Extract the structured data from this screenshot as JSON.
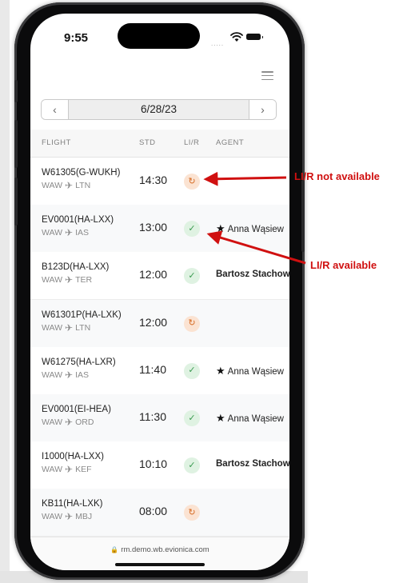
{
  "status_bar": {
    "time": "9:55",
    "signal": "....."
  },
  "date_nav": {
    "prev": "‹",
    "date": "6/28/23",
    "next": "›"
  },
  "table": {
    "headers": {
      "flight": "FLIGHT",
      "std": "STD",
      "lir": "LI/R",
      "agent": "AGENT"
    },
    "rows": [
      {
        "flight": "W61305(G-WUKH)",
        "from": "WAW",
        "to": "LTN",
        "std": "14:30",
        "lir": "not_available",
        "agent": "",
        "starred": false
      },
      {
        "flight": "EV0001(HA-LXX)",
        "from": "WAW",
        "to": "IAS",
        "std": "13:00",
        "lir": "available",
        "agent": "Anna Wąsiew",
        "starred": true
      },
      {
        "flight": "B123D(HA-LXX)",
        "from": "WAW",
        "to": "TER",
        "std": "12:00",
        "lir": "available",
        "agent": "Bartosz Stachow",
        "starred": false
      },
      {
        "flight": "W61301P(HA-LXK)",
        "from": "WAW",
        "to": "LTN",
        "std": "12:00",
        "lir": "not_available",
        "agent": "",
        "starred": false
      },
      {
        "flight": "W61275(HA-LXR)",
        "from": "WAW",
        "to": "IAS",
        "std": "11:40",
        "lir": "available",
        "agent": "Anna Wąsiew",
        "starred": true
      },
      {
        "flight": "EV0001(EI-HEA)",
        "from": "WAW",
        "to": "ORD",
        "std": "11:30",
        "lir": "available",
        "agent": "Anna Wąsiew",
        "starred": true
      },
      {
        "flight": "I1000(HA-LXX)",
        "from": "WAW",
        "to": "KEF",
        "std": "10:10",
        "lir": "available",
        "agent": "Bartosz Stachow",
        "starred": false
      },
      {
        "flight": "KB11(HA-LXK)",
        "from": "WAW",
        "to": "MBJ",
        "std": "08:00",
        "lir": "not_available",
        "agent": "",
        "starred": false
      }
    ]
  },
  "browser": {
    "url": "rm.demo.wb.evionica.com"
  },
  "annotations": {
    "not_available": "LI/R not available",
    "available": "LI/R available"
  },
  "colors": {
    "annotation": "#d01010",
    "lir_not_available": "#d56a22",
    "lir_available": "#3a9a50"
  },
  "icons": {
    "menu": "hamburger-menu-icon",
    "plane": "airplane-icon",
    "refresh": "refresh-icon",
    "check": "checkmark-icon",
    "star": "star-icon",
    "lock": "lock-icon"
  }
}
